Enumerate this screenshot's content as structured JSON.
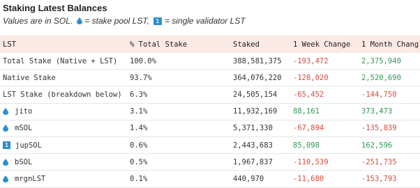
{
  "header": {
    "title": "Staking Latest Balances",
    "subtitle_prefix": "Values are in SOL.",
    "subtitle_pool": "= stake pool LST,",
    "subtitle_single": "= single validator LST",
    "badge_text": "1"
  },
  "table": {
    "columns": [
      "LST",
      "% Total Stake",
      "Staked",
      "1 Week Change",
      "1 Month Chang"
    ],
    "rows": [
      {
        "lst": "Total Stake (Native + LST)",
        "pct": "100.0%",
        "staked": "388,581,375",
        "week": "-193,472",
        "week_sign": "neg",
        "month": "2,375,940",
        "month_sign": "pos",
        "icon": "none"
      },
      {
        "lst": "Native Stake",
        "pct": "93.7%",
        "staked": "364,076,220",
        "week": "-128,020",
        "week_sign": "neg",
        "month": "2,520,690",
        "month_sign": "pos",
        "icon": "none"
      },
      {
        "lst": "LST Stake (breakdown below)",
        "pct": "6.3%",
        "staked": "24,505,154",
        "week": "-65,452",
        "week_sign": "neg",
        "month": "-144,750",
        "month_sign": "neg",
        "icon": "none"
      },
      {
        "lst": "jito",
        "pct": "3.1%",
        "staked": "11,932,169",
        "week": "88,161",
        "week_sign": "pos",
        "month": "373,473",
        "month_sign": "pos",
        "icon": "drop"
      },
      {
        "lst": "mSOL",
        "pct": "1.4%",
        "staked": "5,371,330",
        "week": "-67,894",
        "week_sign": "neg",
        "month": "-135,839",
        "month_sign": "neg",
        "icon": "drop"
      },
      {
        "lst": "jupSOL",
        "pct": "0.6%",
        "staked": "2,443,683",
        "week": "85,098",
        "week_sign": "pos",
        "month": "162,596",
        "month_sign": "pos",
        "icon": "badge"
      },
      {
        "lst": "bSOL",
        "pct": "0.5%",
        "staked": "1,967,837",
        "week": "-110,539",
        "week_sign": "neg",
        "month": "-251,735",
        "month_sign": "neg",
        "icon": "drop"
      },
      {
        "lst": "mrgnLST",
        "pct": "0.1%",
        "staked": "440,970",
        "week": "-11,680",
        "week_sign": "neg",
        "month": "-153,793",
        "month_sign": "neg",
        "icon": "drop"
      }
    ]
  },
  "colors": {
    "header_bg": "#fbe9e5",
    "negative": "#d94b3d",
    "positive": "#2e9a55",
    "icon_blue": "#2a8fcf"
  },
  "icons": {
    "drop": "water-drop-icon",
    "badge": "single-validator-badge-icon"
  }
}
